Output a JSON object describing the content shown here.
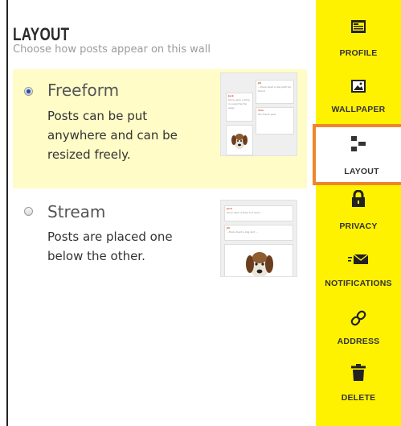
{
  "layout": {
    "title": "LAYOUT",
    "subtitle": "Choose how posts appear on this wall"
  },
  "options": [
    {
      "name": "Freeform",
      "desc_lines": [
        "Posts can be put",
        "anywhere and can be",
        "resized freely."
      ],
      "selected": true
    },
    {
      "name": "Stream",
      "desc_lines": [
        "Posts are placed one",
        "below the other."
      ],
      "selected": false
    }
  ],
  "freeform_thumb": {
    "cards": [
      {
        "heading": "Jill",
        "text": "...there lived a dog with his friend"
      },
      {
        "heading": "Jack",
        "text": "Once upon a time in a land far far away"
      },
      {
        "heading": "Tom",
        "text": "His friend, Jack"
      }
    ]
  },
  "stream_thumb": {
    "cards": [
      {
        "heading": "Jack",
        "text": "Once upon a time in a land..."
      },
      {
        "heading": "Jill",
        "text": "...there lived a dog and ...."
      }
    ]
  },
  "sidebar": {
    "accent": "#fff200",
    "active_border": "#f1852d",
    "items": [
      {
        "label": "PROFILE",
        "icon": "profile-icon"
      },
      {
        "label": "WALLPAPER",
        "icon": "wallpaper-icon"
      },
      {
        "label": "LAYOUT",
        "icon": "layout-icon",
        "active": true
      },
      {
        "label": "PRIVACY",
        "icon": "lock-icon"
      },
      {
        "label": "NOTIFICATIONS",
        "icon": "envelope-icon"
      },
      {
        "label": "ADDRESS",
        "icon": "link-icon"
      },
      {
        "label": "DELETE",
        "icon": "trash-icon"
      }
    ]
  }
}
